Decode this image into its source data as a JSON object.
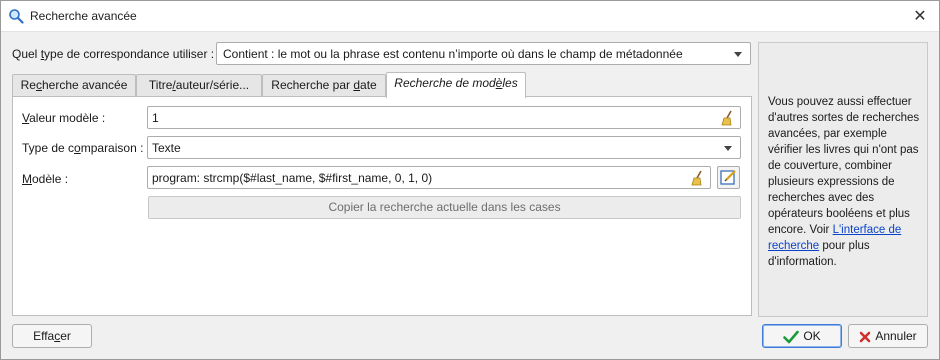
{
  "window": {
    "title": "Recherche avancée",
    "close_glyph": "✕",
    "icon": "search-icon"
  },
  "match_type": {
    "label_pre": "Quel ",
    "label_mn": "t",
    "label_post": "ype de correspondance utiliser :",
    "selected": "Contient : le mot ou la phrase est contenu n’importe où dans le champ de métadonnée"
  },
  "tabs": [
    {
      "pre": "Re",
      "mn": "c",
      "post": "herche avancée"
    },
    {
      "pre": "Titre",
      "mn": "/",
      "post": "auteur/série..."
    },
    {
      "pre": "Recherche par ",
      "mn": "d",
      "post": "ate"
    },
    {
      "pre": "Recherche de mod",
      "mn": "è",
      "post": "les"
    }
  ],
  "active_tab_index": 3,
  "template_search": {
    "value_label_pre": "",
    "value_label_mn": "V",
    "value_label_post": "aleur modèle :",
    "value": "1",
    "comparison_label_pre": "Type de c",
    "comparison_label_mn": "o",
    "comparison_label_post": "mparaison :",
    "comparison_value": "Texte",
    "template_label_pre": "",
    "template_label_mn": "M",
    "template_label_post": "odèle :",
    "template_value": "program: strcmp($#last_name, $#first_name, 0, 1, 0)",
    "copy_button": "Copier la recherche actuelle dans les cases"
  },
  "help": {
    "text": "Vous pouvez aussi effectuer d'autres sortes de recherches avancées, par exemple vérifier les livres qui n'ont pas de couverture, combiner plusieurs expressions de recherches avec des opérateurs booléens et plus encore. Voir",
    "link": "L'interface de recherche",
    "text_after": "pour plus d'information."
  },
  "buttons": {
    "clear_pre": "Effa",
    "clear_mn": "c",
    "clear_post": "er",
    "ok": "OK",
    "cancel": "Annuler"
  },
  "colors": {
    "ok_check": "#1a9b3c",
    "cancel_x": "#d0312d",
    "link": "#0b43c8",
    "broom": "#c9a227"
  }
}
